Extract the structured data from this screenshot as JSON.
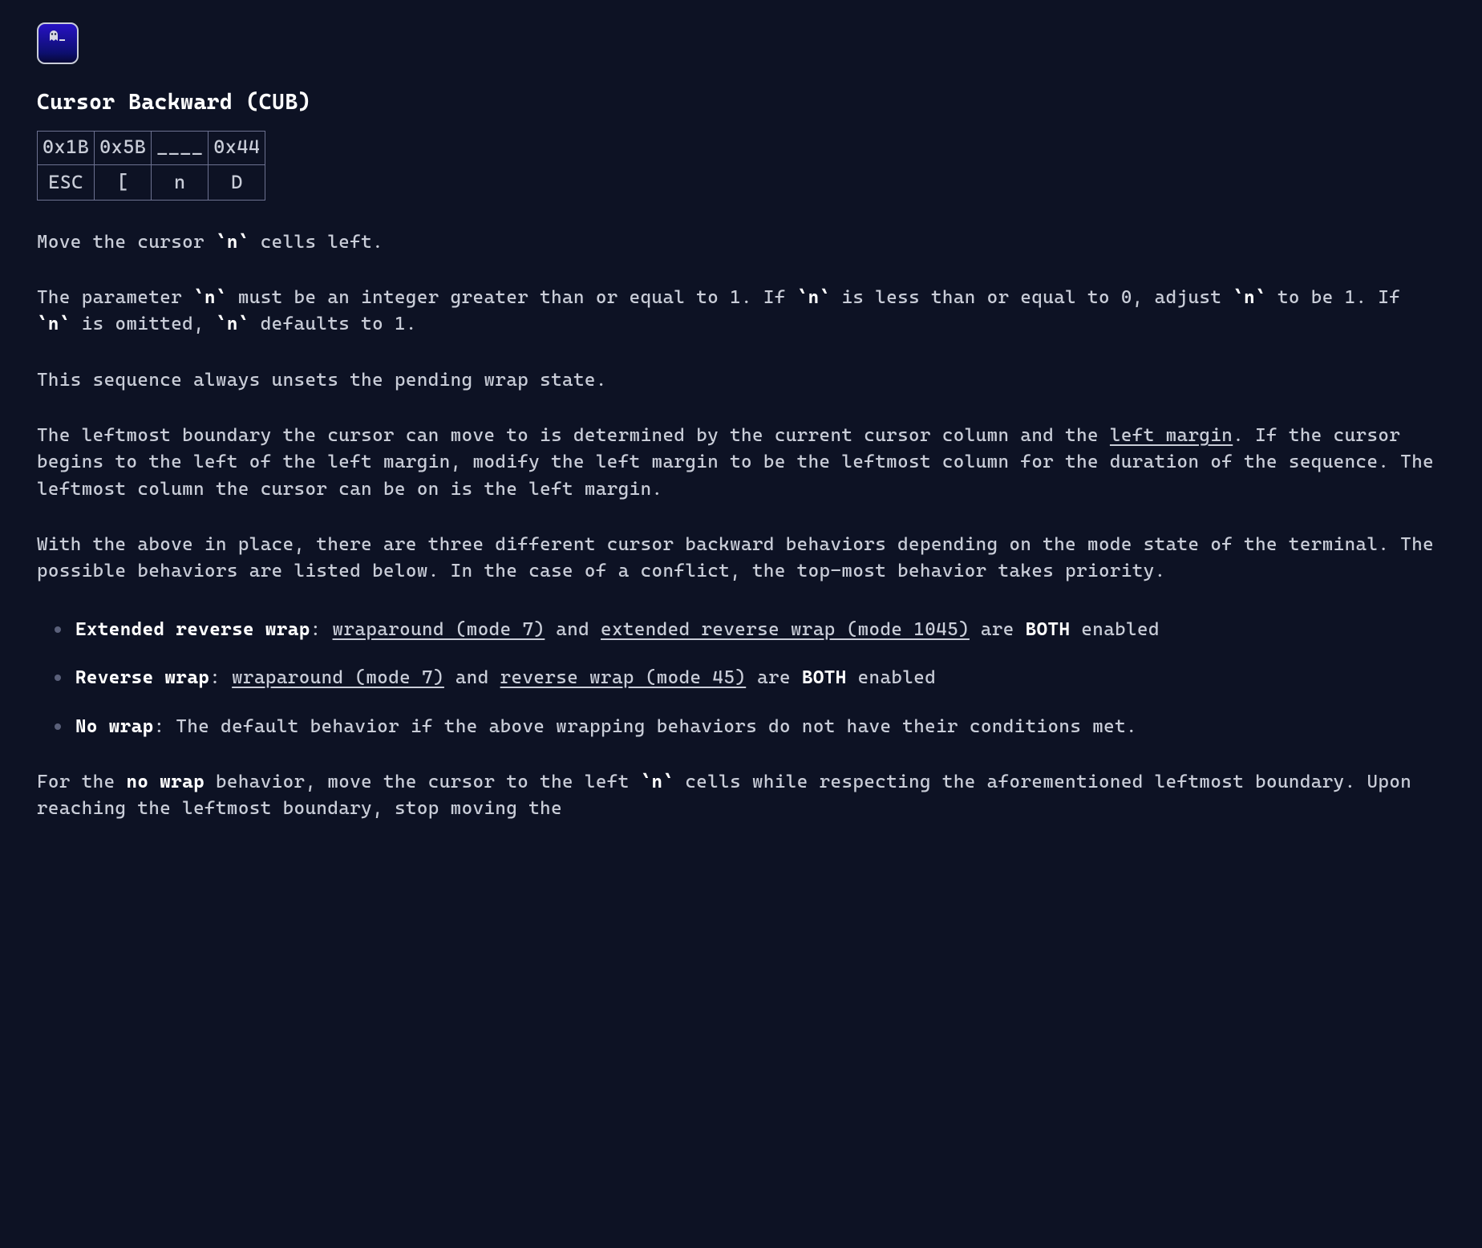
{
  "logo": {
    "name": "ghostty-logo"
  },
  "title": "Cursor Backward (CUB)",
  "seq": {
    "hex": [
      "0x1B",
      "0x5B",
      "____",
      "0x44"
    ],
    "chr": [
      "ESC",
      "[",
      "n",
      "D"
    ]
  },
  "p1": {
    "t1": "Move the cursor ",
    "c1": "`n`",
    "t2": " cells left."
  },
  "p2": {
    "t1": "The parameter ",
    "c1": "`n`",
    "t2": " must be an integer greater than or equal to 1. If ",
    "c2": "`n`",
    "t3": " is less than or equal to 0, adjust ",
    "c3": "`n`",
    "t4": " to be 1. If ",
    "c4": "`n`",
    "t5": " is omitted, ",
    "c5": "`n`",
    "t6": " defaults to 1."
  },
  "p3": "This sequence always unsets the pending wrap state.",
  "p4": {
    "t1": "The leftmost boundary the cursor can move to is determined by the current cursor column and the ",
    "link": "left margin",
    "t2": ". If the cursor begins to the left of the left margin, modify the left margin to be the leftmost column for the duration of the sequence. The leftmost column the cursor can be on is the left margin."
  },
  "p5": "With the above in place, there are three different cursor backward behaviors depending on the mode state of the terminal. The possible behaviors are listed below. In the case of a conflict, the top-most behavior takes priority.",
  "list": {
    "i1": {
      "bold": "Extended reverse wrap",
      "t1": ": ",
      "link1": "wraparound (mode 7)",
      "t2": " and ",
      "link2": "extended reverse wrap (mode 1045)",
      "t3": " are ",
      "bold2": "BOTH",
      "t4": " enabled"
    },
    "i2": {
      "bold": "Reverse wrap",
      "t1": ": ",
      "link1": "wraparound (mode 7)",
      "t2": " and ",
      "link2": "reverse wrap (mode 45)",
      "t3": " are ",
      "bold2": "BOTH",
      "t4": " enabled"
    },
    "i3": {
      "bold": "No wrap",
      "t1": ": The default behavior if the above wrapping behaviors do not have their conditions met."
    }
  },
  "p6": {
    "t1": "For the ",
    "bold": "no wrap",
    "t2": " behavior, move the cursor to the left ",
    "c1": "`n`",
    "t3": " cells while respecting the aforementioned leftmost boundary. Upon reaching the leftmost boundary, stop moving the"
  }
}
